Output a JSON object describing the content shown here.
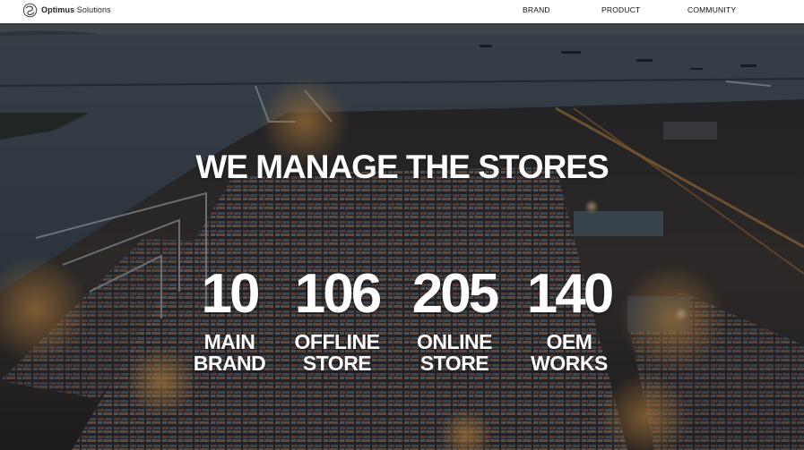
{
  "header": {
    "logo_bold": "Optimus",
    "logo_rest": " Solutions",
    "logo_icon": "swirl-logo-icon",
    "nav": [
      {
        "label": "BRAND"
      },
      {
        "label": "PRODUCT"
      },
      {
        "label": "COMMUNITY"
      }
    ]
  },
  "hero": {
    "background": "night-aerial-container-port",
    "headline": "WE MANAGE THE STORES",
    "stats": [
      {
        "number": "10",
        "label_line1": "MAIN",
        "label_line2": "BRAND"
      },
      {
        "number": "106",
        "label_line1": "OFFLINE",
        "label_line2": "STORE"
      },
      {
        "number": "205",
        "label_line1": "ONLINE",
        "label_line2": "STORE"
      },
      {
        "number": "140",
        "label_line1": "OEM",
        "label_line2": "WORKS"
      }
    ]
  },
  "colors": {
    "header_bg": "#ffffff",
    "text_dark": "#111111",
    "hero_text": "#ffffff",
    "water": "#3d4c58",
    "port_lights": "#e8a24a"
  }
}
